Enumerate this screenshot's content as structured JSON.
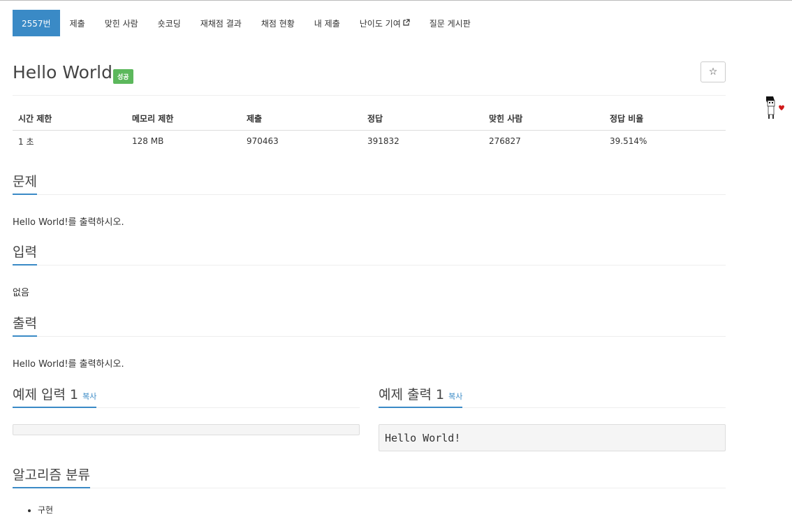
{
  "nav": {
    "tabs": [
      {
        "label": "2557번",
        "active": true
      },
      {
        "label": "제출"
      },
      {
        "label": "맞힌 사람"
      },
      {
        "label": "숏코딩"
      },
      {
        "label": "재채점 결과"
      },
      {
        "label": "채점 현황"
      },
      {
        "label": "내 제출"
      },
      {
        "label": "난이도 기여",
        "external": true
      },
      {
        "label": "질문 게시판"
      }
    ]
  },
  "problem": {
    "title": "Hello World",
    "badge": "성공",
    "star_icon": "star-icon"
  },
  "info": {
    "headers": [
      "시간 제한",
      "메모리 제한",
      "제출",
      "정답",
      "맞힌 사람",
      "정답 비율"
    ],
    "values": [
      "1 초",
      "128 MB",
      "970463",
      "391832",
      "276827",
      "39.514%"
    ]
  },
  "sections": {
    "problem_head": "문제",
    "problem_text": "Hello World!를 출력하시오.",
    "input_head": "입력",
    "input_text": "없음",
    "output_head": "출력",
    "output_text": "Hello World!를 출력하시오.",
    "sample_input_head": "예제 입력 1",
    "sample_output_head": "예제 출력 1",
    "copy_label": "복사",
    "sample_input": "",
    "sample_output": "Hello World!",
    "algo_head": "알고리즘 분류",
    "algo_items": [
      "구현"
    ]
  },
  "colors": {
    "accent": "#3a8ac6",
    "badge": "#5cb85c"
  }
}
